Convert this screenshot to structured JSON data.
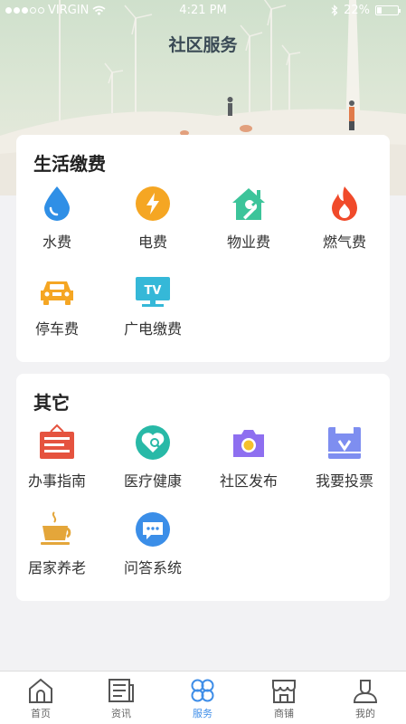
{
  "status_bar": {
    "carrier": "VIRGIN",
    "time": "4:21 PM",
    "battery": "22%",
    "battery_level": 0.22
  },
  "header": {
    "title": "社区服务"
  },
  "life_payment": {
    "title": "生活缴费",
    "items": [
      {
        "label": "水费",
        "icon": "water-drop-icon",
        "color": "#2f8fe6"
      },
      {
        "label": "电费",
        "icon": "lightning-icon",
        "color": "#f5a623"
      },
      {
        "label": "物业费",
        "icon": "house-wrench-icon",
        "color": "#3cc49a"
      },
      {
        "label": "燃气费",
        "icon": "flame-icon",
        "color": "#f04a2a"
      },
      {
        "label": "停车费",
        "icon": "car-icon",
        "color": "#f5a623"
      },
      {
        "label": "广电缴费",
        "icon": "tv-icon",
        "color": "#35b8d8"
      }
    ]
  },
  "other": {
    "title": "其它",
    "items": [
      {
        "label": "办事指南",
        "icon": "notice-board-icon",
        "color": "#e5533f"
      },
      {
        "label": "医疗健康",
        "icon": "heart-search-icon",
        "color": "#28b9a7"
      },
      {
        "label": "社区发布",
        "icon": "camera-icon",
        "color": "#8e6ff0"
      },
      {
        "label": "我要投票",
        "icon": "ballot-box-icon",
        "color": "#7e8ef0"
      },
      {
        "label": "居家养老",
        "icon": "teacup-icon",
        "color": "#e4a63a"
      },
      {
        "label": "问答系统",
        "icon": "chat-bubble-icon",
        "color": "#3b8ee8"
      }
    ]
  },
  "tabbar": {
    "active_color": "#3f8ee8",
    "tabs": [
      {
        "label": "首页",
        "icon": "home-icon"
      },
      {
        "label": "资讯",
        "icon": "newspaper-icon"
      },
      {
        "label": "服务",
        "icon": "clover-icon",
        "active": true
      },
      {
        "label": "商铺",
        "icon": "store-icon"
      },
      {
        "label": "我的",
        "icon": "user-icon"
      }
    ]
  }
}
